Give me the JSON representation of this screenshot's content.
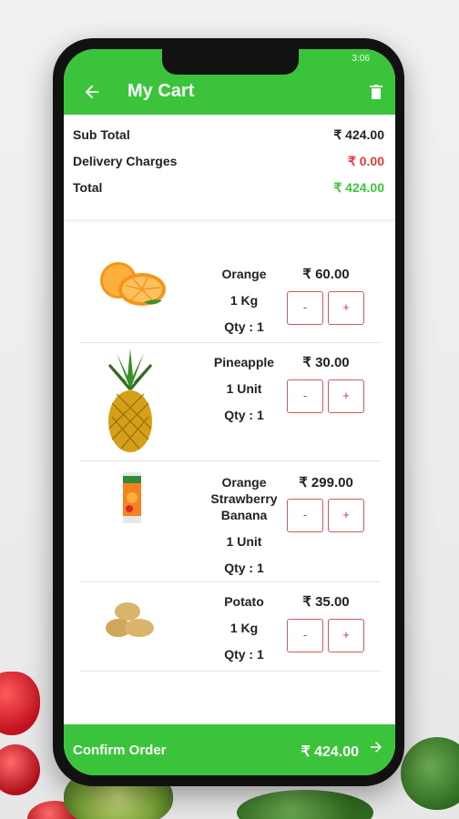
{
  "status_bar": {
    "left": "",
    "right": "3:06"
  },
  "app_bar": {
    "back_icon": "arrow-left-icon",
    "title": "My Cart",
    "trash_icon": "trash-icon",
    "color": "#3bc43b"
  },
  "summary": {
    "sub_total_label": "Sub Total",
    "sub_total_value": "₹ 424.00",
    "delivery_label": "Delivery Charges",
    "delivery_value": "₹ 0.00",
    "delivery_color": "#e03b3b",
    "total_label": "Total",
    "total_value": "₹ 424.00",
    "total_color": "#3bc43b"
  },
  "items": [
    {
      "name_lines": [
        "Orange"
      ],
      "unit": "1 Kg",
      "qty": "Qty : 1",
      "price": "₹ 60.00",
      "minus": "-",
      "plus": "+",
      "image": "orange-image"
    },
    {
      "name_lines": [
        "Pineapple"
      ],
      "unit": "1 Unit",
      "qty": "Qty : 1",
      "price": "₹ 30.00",
      "minus": "-",
      "plus": "+",
      "image": "pineapple-image"
    },
    {
      "name_lines": [
        "Orange",
        "Strawberry",
        "Banana"
      ],
      "unit": "1 Unit",
      "qty": "Qty : 1",
      "price": "₹ 299.00",
      "minus": "-",
      "plus": "+",
      "image": "juice-pack-image"
    },
    {
      "name_lines": [
        "Potato"
      ],
      "unit": "1 Kg",
      "qty": "Qty : 1",
      "price": "₹ 35.00",
      "minus": "-",
      "plus": "+",
      "image": "potato-image"
    }
  ],
  "confirm": {
    "label": "Confirm Order",
    "total": "₹ 424.00",
    "arrow_icon": "arrow-right-icon"
  }
}
